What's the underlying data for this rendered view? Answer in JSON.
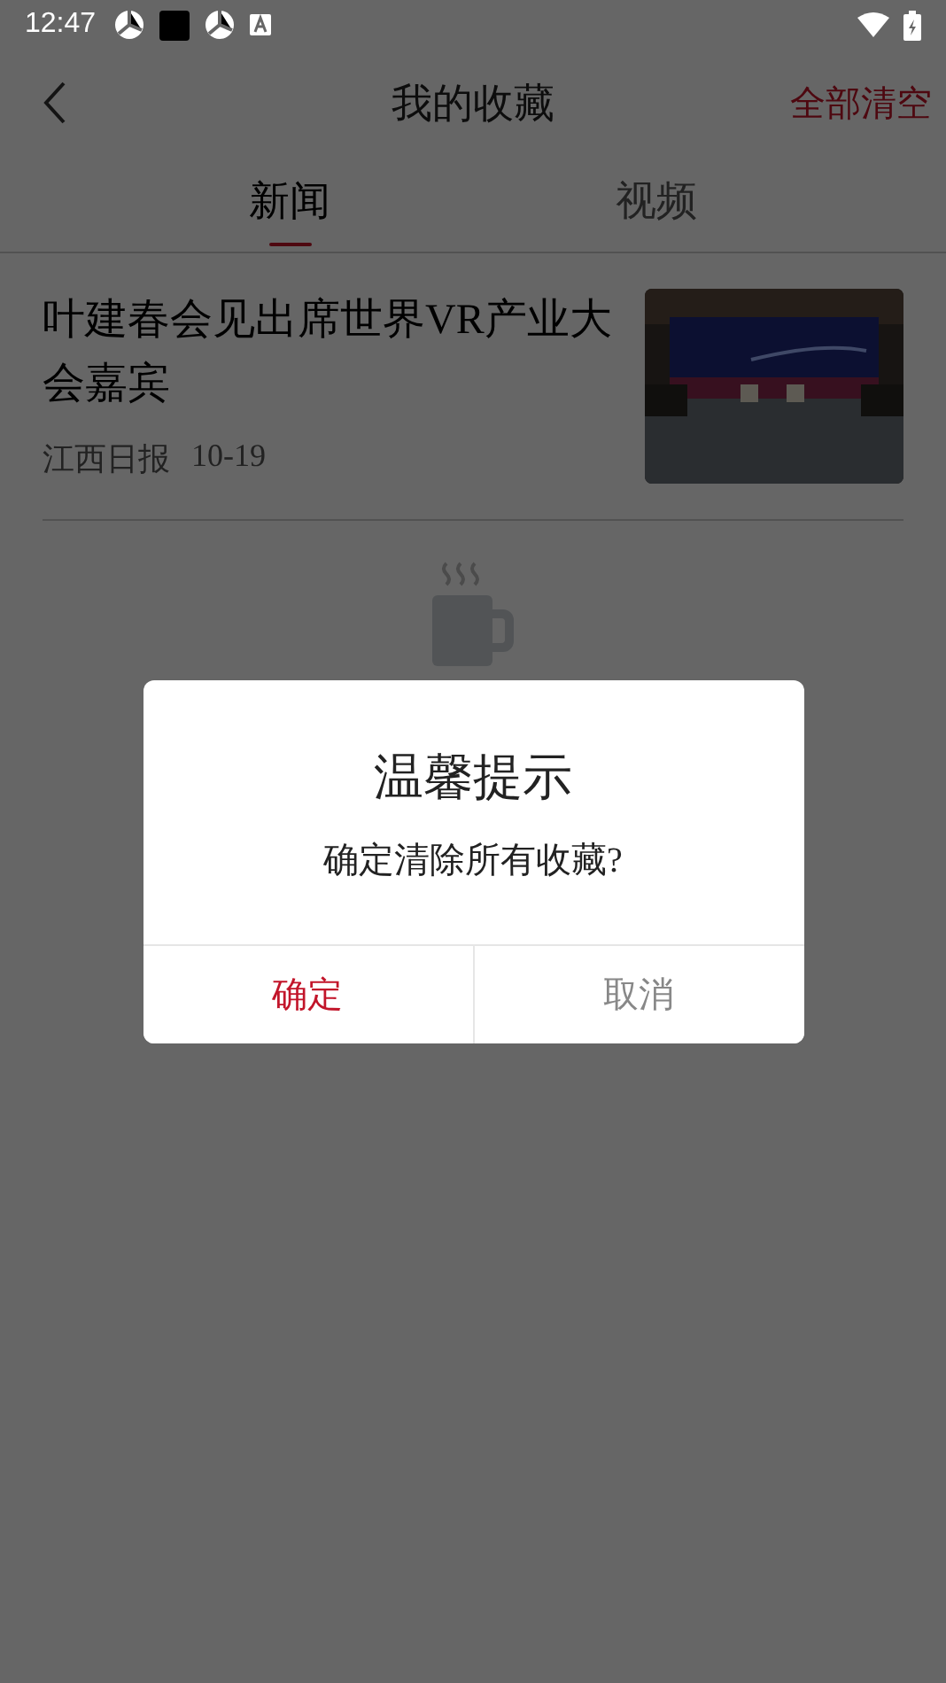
{
  "status_bar": {
    "time": "12:47"
  },
  "header": {
    "title": "我的收藏",
    "action": "全部清空"
  },
  "tabs": [
    {
      "label": "新闻",
      "selected": true
    },
    {
      "label": "视频",
      "selected": false
    }
  ],
  "items": [
    {
      "title": "叶建春会见出席世界VR产业大会嘉宾",
      "source": "江西日报",
      "date": "10-19"
    }
  ],
  "dialog": {
    "title": "温馨提示",
    "message": "确定清除所有收藏?",
    "buttons": [
      {
        "label": "确定",
        "kind": "confirm"
      },
      {
        "label": "取消",
        "kind": "cancel"
      }
    ]
  }
}
